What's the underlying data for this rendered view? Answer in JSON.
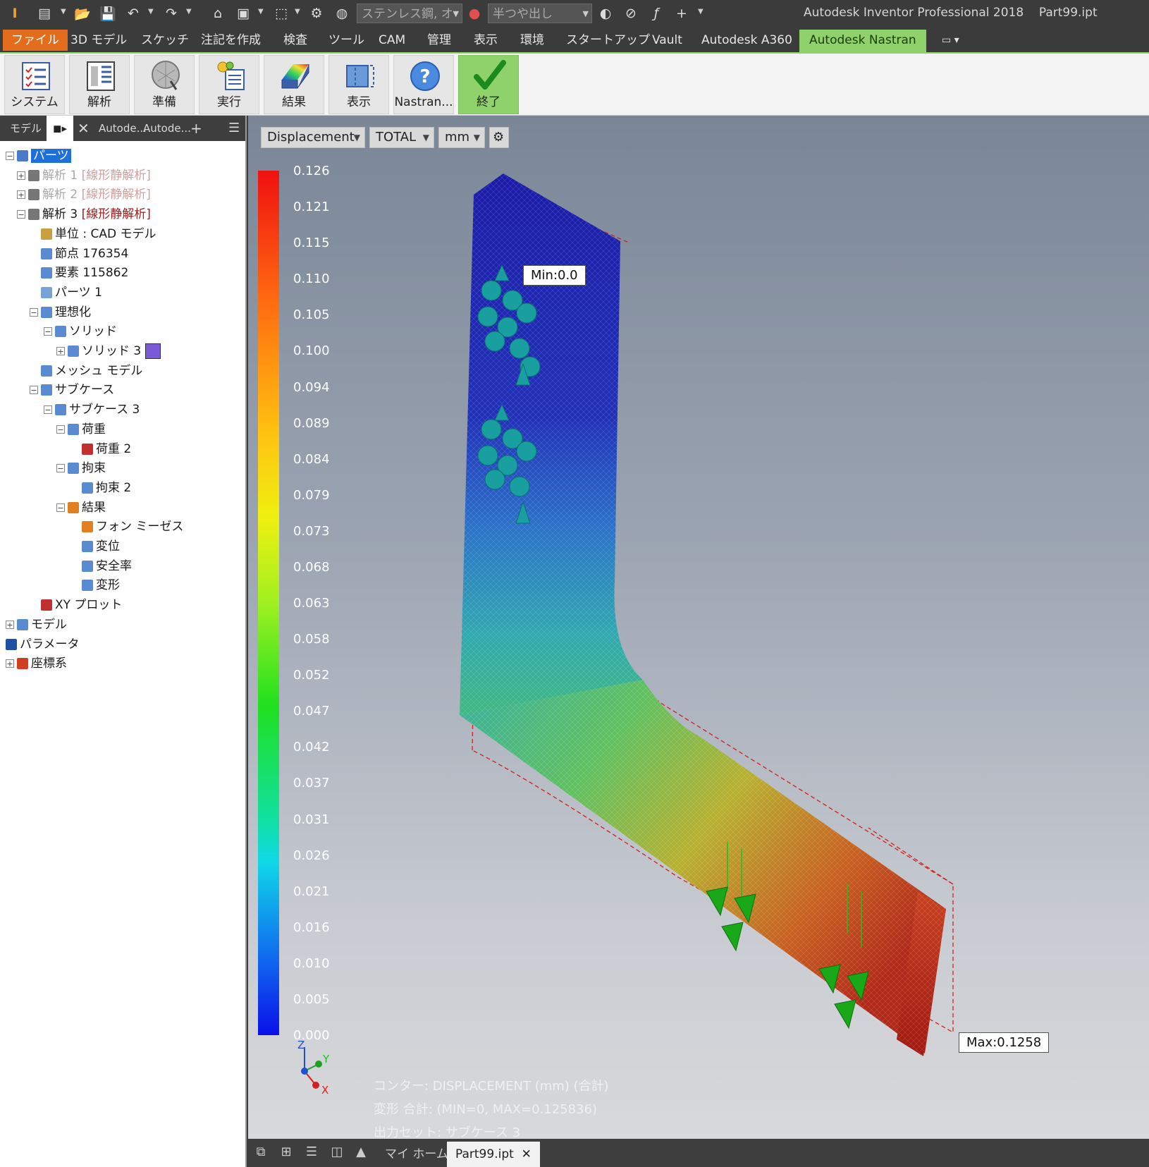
{
  "app": {
    "title": "Autodesk Inventor Professional 2018",
    "file": "Part99.ipt",
    "material_combo": "ステンレス鋼, オ",
    "appearance_combo": "半つや出し"
  },
  "menu": {
    "file": "ファイル",
    "tabs": [
      "3D モデル",
      "スケッチ",
      "注記を作成",
      "検査",
      "ツール",
      "CAM",
      "管理",
      "表示",
      "環境",
      "スタートアップ",
      "Vault",
      "Autodesk A360"
    ],
    "active": "Autodesk Nastran"
  },
  "ribbon": {
    "buttons": [
      "システム",
      "解析",
      "準備",
      "実行",
      "結果",
      "表示",
      "Nastran...",
      "終了"
    ]
  },
  "panel": {
    "tabs": [
      "モデル",
      "Autode...",
      "Autode..."
    ],
    "tree": [
      {
        "label": "パーツ",
        "suffix": "",
        "style": "selected"
      },
      {
        "label": "解析 1",
        "suffix": "[線形静解析]",
        "style": "gray"
      },
      {
        "label": "解析 2",
        "suffix": "[線形静解析]",
        "style": "gray"
      },
      {
        "label": "解析 3",
        "suffix": "[線形静解析]",
        "style": "normal"
      },
      {
        "label": "単位 : CAD モデル",
        "suffix": "",
        "style": "normal"
      },
      {
        "label": "節点 176354",
        "suffix": "",
        "style": "normal"
      },
      {
        "label": "要素 115862",
        "suffix": "",
        "style": "normal"
      },
      {
        "label": "パーツ 1",
        "suffix": "",
        "style": "normal"
      },
      {
        "label": "理想化",
        "suffix": "",
        "style": "normal"
      },
      {
        "label": "ソリッド",
        "suffix": "",
        "style": "normal"
      },
      {
        "label": "ソリッド 3",
        "suffix": "",
        "style": "normal"
      },
      {
        "label": "メッシュ モデル",
        "suffix": "",
        "style": "normal"
      },
      {
        "label": "サブケース",
        "suffix": "",
        "style": "normal"
      },
      {
        "label": "サブケース 3",
        "suffix": "",
        "style": "normal"
      },
      {
        "label": "荷重",
        "suffix": "",
        "style": "normal"
      },
      {
        "label": "荷重 2",
        "suffix": "",
        "style": "normal"
      },
      {
        "label": "拘束",
        "suffix": "",
        "style": "normal"
      },
      {
        "label": "拘束 2",
        "suffix": "",
        "style": "normal"
      },
      {
        "label": "結果",
        "suffix": "",
        "style": "normal"
      },
      {
        "label": "フォン ミーゼス",
        "suffix": "",
        "style": "normal"
      },
      {
        "label": "変位",
        "suffix": "",
        "style": "normal"
      },
      {
        "label": "安全率",
        "suffix": "",
        "style": "normal"
      },
      {
        "label": "変形",
        "suffix": "",
        "style": "normal"
      },
      {
        "label": "XY プロット",
        "suffix": "",
        "style": "normal"
      },
      {
        "label": "モデル",
        "suffix": "",
        "style": "normal"
      },
      {
        "label": "パラメータ",
        "suffix": "",
        "style": "normal"
      },
      {
        "label": "座標系",
        "suffix": "",
        "style": "normal"
      }
    ]
  },
  "viewport": {
    "result_type": "Displacement",
    "component": "TOTAL",
    "unit": "mm",
    "scale": [
      "0.126",
      "0.121",
      "0.115",
      "0.110",
      "0.105",
      "0.100",
      "0.094",
      "0.089",
      "0.084",
      "0.079",
      "0.073",
      "0.068",
      "0.063",
      "0.058",
      "0.052",
      "0.047",
      "0.042",
      "0.037",
      "0.031",
      "0.026",
      "0.021",
      "0.016",
      "0.010",
      "0.005",
      "0.000"
    ],
    "min_label": "Min:0.0",
    "max_label": "Max:0.1258",
    "info": [
      "コンター: DISPLACEMENT (mm) (合計)",
      "変形 合計: (MIN=0, MAX=0.125836)",
      "出力セット: サブケース 3"
    ],
    "axis": {
      "z": "Z",
      "y": "Y",
      "x": "X"
    }
  },
  "statusbar": {
    "home": "マイ ホーム",
    "doc": "Part99.ipt"
  },
  "colors": {
    "file_tab": "#e46d1d",
    "nastran_tab": "#8fd16b",
    "selection": "#1e6fd9"
  }
}
